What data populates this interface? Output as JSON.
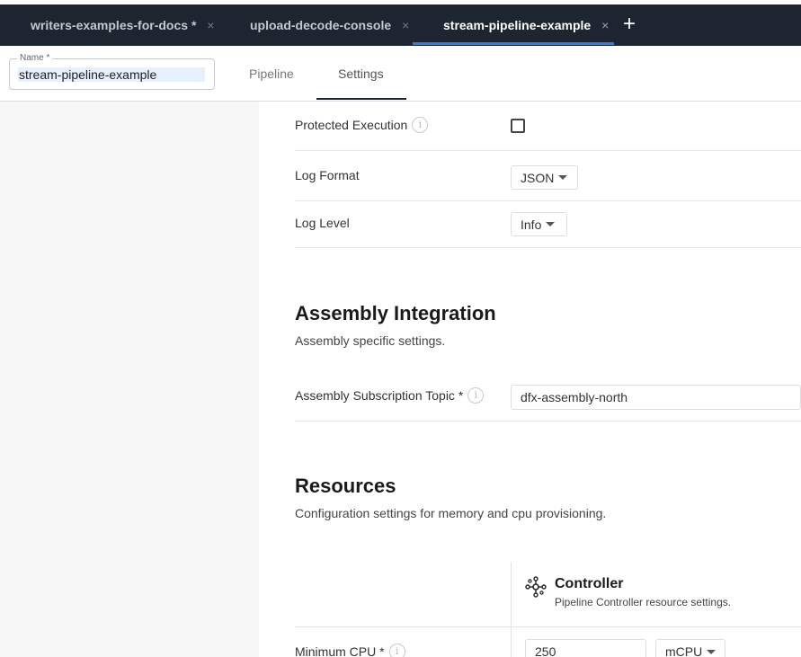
{
  "tabs": [
    {
      "label": "writers-examples-for-docs *",
      "close": "×"
    },
    {
      "label": "upload-decode-console",
      "close": "×"
    },
    {
      "label": "stream-pipeline-example",
      "close": "×"
    }
  ],
  "add_tab": "+",
  "name_field": {
    "legend": "Name *",
    "value": "stream-pipeline-example"
  },
  "header_tabs": [
    "Pipeline",
    "Settings"
  ],
  "settings": {
    "protected_execution": {
      "label": "Protected Execution",
      "checked": false
    },
    "log_format": {
      "label": "Log Format",
      "value": "JSON"
    },
    "log_level": {
      "label": "Log Level",
      "value": "Info"
    }
  },
  "assembly": {
    "title": "Assembly Integration",
    "description": "Assembly specific settings.",
    "topic_label": "Assembly Subscription Topic *",
    "topic_value": "dfx-assembly-north"
  },
  "resources": {
    "title": "Resources",
    "description": "Configuration settings for memory and cpu provisioning.",
    "controller_title": "Controller",
    "controller_desc": "Pipeline Controller resource settings.",
    "min_cpu_label": "Minimum CPU *",
    "min_cpu_value": "250",
    "min_cpu_unit": "mCPU"
  },
  "icons": {
    "info": "info-icon",
    "controller": "controller-icon",
    "caret": "chevron-down-icon"
  },
  "colors": {
    "tabbar_bg": "#1d2630",
    "active_tab_underline": "#2f7fd8",
    "left_panel": "#f7f7f7"
  }
}
